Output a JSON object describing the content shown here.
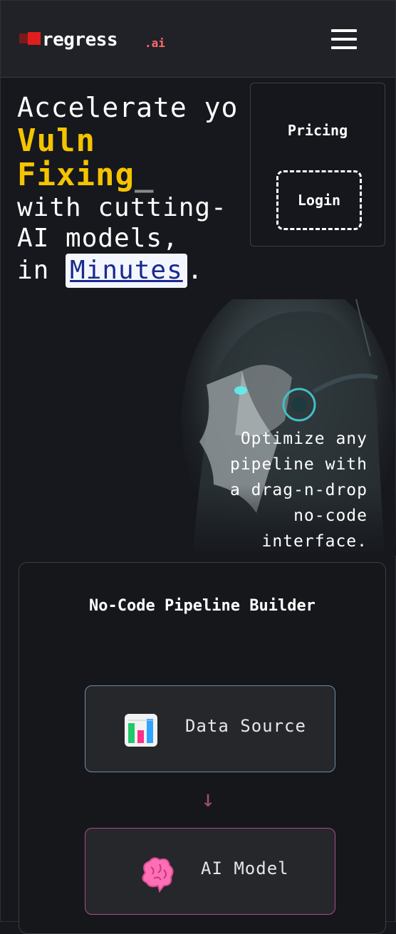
{
  "header": {
    "logo_text": "regress",
    "logo_suffix": ".ai",
    "menu_icon": "hamburger-menu-icon"
  },
  "hero": {
    "line1": "Accelerate yo",
    "line2": "Vuln",
    "line3": "Fixing",
    "cursor": "_",
    "line4": "with cutting-",
    "line5": "AI models,",
    "line6_prefix": "in ",
    "line6_highlight": "Minutes",
    "line6_suffix": "."
  },
  "menu": {
    "pricing": "Pricing",
    "login": "Login"
  },
  "tagline": {
    "line1": "Optimize any",
    "line2": "pipeline with",
    "line3": "a drag-n-drop",
    "line4": "no-code",
    "line5": "interface."
  },
  "builder": {
    "title": "No-Code Pipeline Builder",
    "nodes": [
      {
        "label": "Data Source",
        "icon": "bar-chart-icon"
      },
      {
        "label": "AI Model",
        "icon": "brain-icon"
      }
    ],
    "arrow": "↓"
  },
  "colors": {
    "accent_yellow": "#f5c400",
    "logo_red": "#e01e1e",
    "background": "#16181d"
  }
}
